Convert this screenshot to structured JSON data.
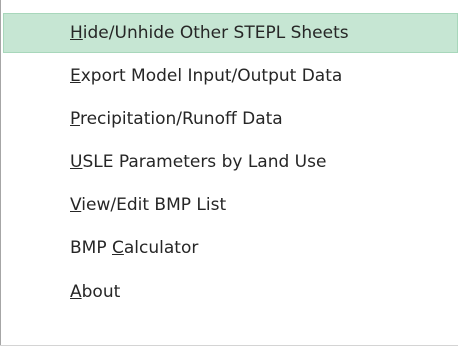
{
  "menu": {
    "items": [
      {
        "before": "",
        "key": "H",
        "after": "ide/Unhide Other STEPL Sheets",
        "highlighted": true
      },
      {
        "before": "",
        "key": "E",
        "after": "xport Model Input/Output Data",
        "highlighted": false
      },
      {
        "before": "",
        "key": "P",
        "after": "recipitation/Runoff Data",
        "highlighted": false
      },
      {
        "before": "",
        "key": "U",
        "after": "SLE Parameters by Land Use",
        "highlighted": false
      },
      {
        "before": "",
        "key": "V",
        "after": "iew/Edit BMP List",
        "highlighted": false
      },
      {
        "before": "BMP ",
        "key": "C",
        "after": "alculator",
        "highlighted": false
      },
      {
        "before": "",
        "key": "A",
        "after": "bout",
        "highlighted": false
      }
    ],
    "colors": {
      "highlight_background": "#c6e6d3",
      "highlight_border": "#a8d7bb",
      "text": "#262626"
    }
  }
}
